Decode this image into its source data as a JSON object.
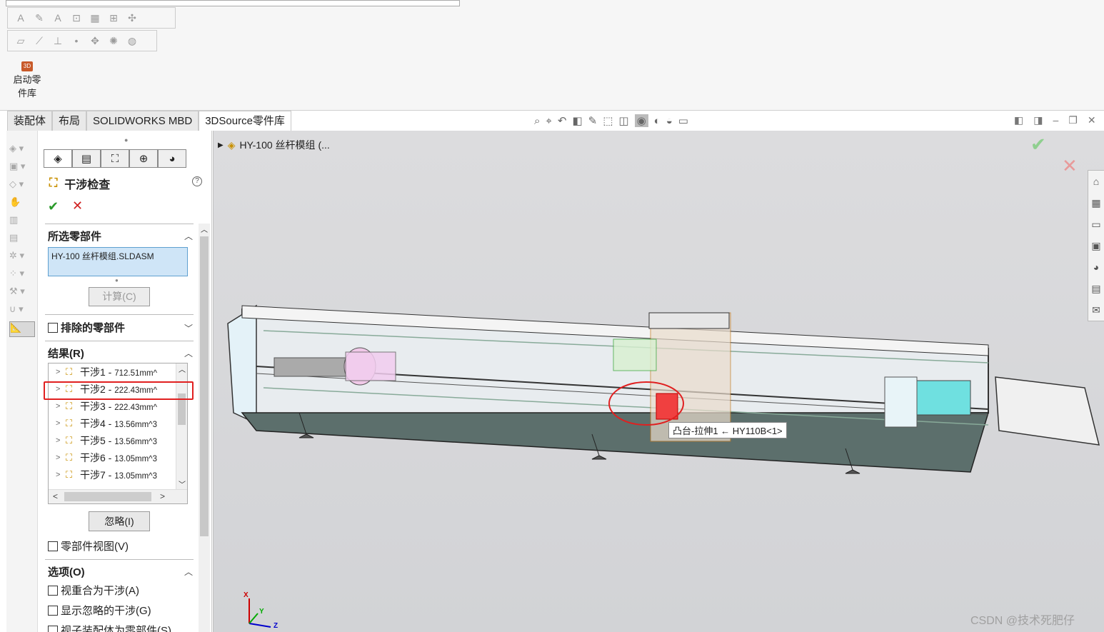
{
  "ribbon": {
    "launch_label_line1": "启动零",
    "launch_label_line2": "件库",
    "launch_icon_text": "3D"
  },
  "tabs": [
    "装配体",
    "布局",
    "SOLIDWORKS MBD",
    "3DSource零件库"
  ],
  "panel": {
    "title": "干涉检查",
    "help_symbol": "?",
    "ok_symbol": "✔",
    "cancel_symbol": "✕",
    "selected_section": "所选零部件",
    "selected_item": "HY-100 丝杆模组.SLDASM",
    "calculate_button": "计算(C)",
    "excluded_section": "排除的零部件",
    "results_section": "结果(R)",
    "results": [
      {
        "name": "干涉1",
        "value": "712.51mm^"
      },
      {
        "name": "干涉2",
        "value": "222.43mm^"
      },
      {
        "name": "干涉3",
        "value": "222.43mm^"
      },
      {
        "name": "干涉4",
        "value": "13.56mm^3"
      },
      {
        "name": "干涉5",
        "value": "13.56mm^3"
      },
      {
        "name": "干涉6",
        "value": "13.05mm^3"
      },
      {
        "name": "干涉7",
        "value": "13.05mm^3"
      }
    ],
    "ignore_button": "忽略(I)",
    "component_view": "零部件视图(V)",
    "options_section": "选项(O)",
    "options": [
      "视重合为干涉(A)",
      "显示忽略的干涉(G)",
      "视子装配体为零部件(S)"
    ]
  },
  "viewport": {
    "doc_title": "HY-100 丝杆模组 (...",
    "tooltip": "凸台-拉伸1 ← HY110B<1>",
    "watermark": "CSDN @技术死肥仔",
    "axis_x": "X",
    "axis_y": "Y",
    "axis_z": "Z"
  },
  "colors": {
    "highlight_red": "#e02020",
    "selection_blue": "#cfe5f7",
    "accept_green": "#2a9a2a"
  }
}
